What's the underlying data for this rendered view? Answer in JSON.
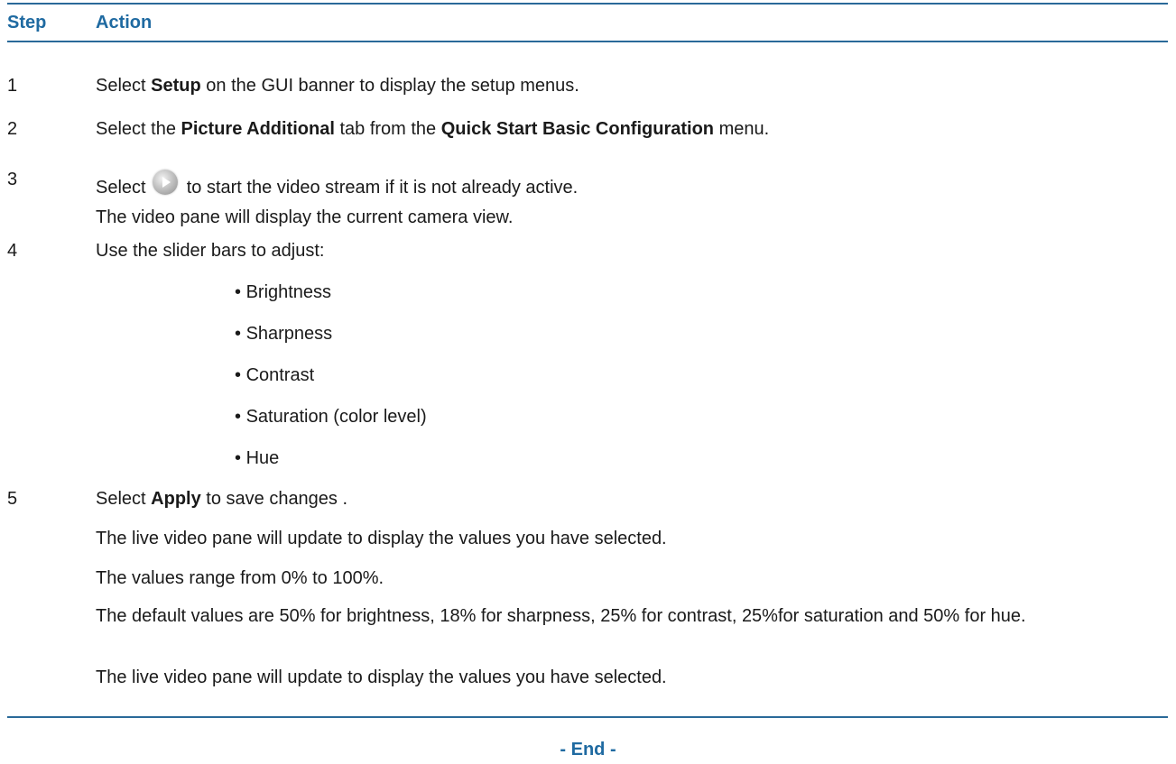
{
  "header": {
    "step": "Step",
    "action": "Action"
  },
  "steps": [
    {
      "num": "1",
      "lines": [
        {
          "pre": "Select ",
          "bold": "Setup",
          "post": " on the GUI banner to display the setup menus."
        }
      ]
    },
    {
      "num": "2",
      "pre": "Select the ",
      "bold1": "Picture Additional",
      "mid": " tab from the ",
      "bold2": "Quick Start Basic Configuration",
      "post": " menu."
    },
    {
      "num": "3",
      "pre": "Select ",
      "post": " to start the video stream if it is not already active.",
      "note": "The video pane will display the current camera view."
    },
    {
      "num": "4",
      "text": "Use the slider bars to adjust:",
      "bullets": [
        "Brightness",
        "Sharpness",
        "Contrast",
        "Saturation (color level)",
        "Hue"
      ]
    },
    {
      "num": "5",
      "pre": "Select ",
      "bold": "Apply",
      "post": " to save changes .",
      "notes": [
        "The live video pane will update to display the values you have selected.",
        "The values range from 0% to 100%.",
        "The default values are 50% for brightness, 18% for sharpness, 25% for contrast, 25%for saturation and 50% for hue.",
        "The live video pane will update to display the values you have selected."
      ]
    }
  ],
  "footer": {
    "end": "- End -"
  },
  "icons": {
    "play": "play-icon"
  },
  "colors": {
    "accent": "#1f6aa1",
    "rule": "#2a6a99"
  }
}
